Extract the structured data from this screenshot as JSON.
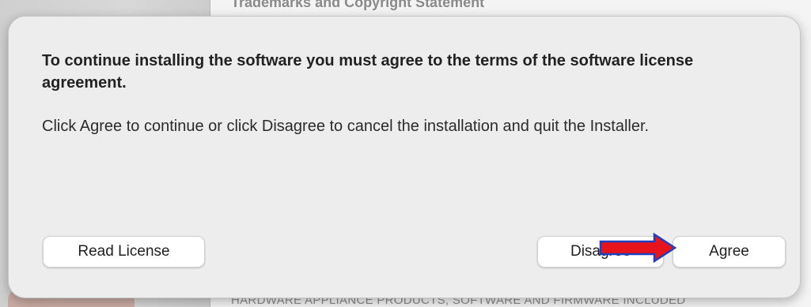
{
  "background": {
    "top_text": "Trademarks and Copyright Statement",
    "bottom_text": "HARDWARE APPLIANCE PRODUCTS, SOFTWARE AND FIRMWARE INCLUDED"
  },
  "dialog": {
    "title": "To continue installing the software you must agree to the terms of the software license agreement.",
    "message": "Click Agree to continue or click Disagree to cancel the installation and quit the Installer.",
    "read_license_label": "Read License",
    "disagree_label": "Disagree",
    "agree_label": "Agree"
  },
  "annotation": {
    "arrow_fill": "#e8141b",
    "arrow_stroke": "#1f3fbf",
    "icon": "right-arrow-icon"
  }
}
